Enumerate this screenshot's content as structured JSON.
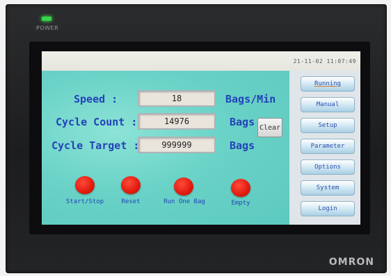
{
  "device": {
    "power_label": "POWER",
    "brand": "OMRON",
    "led_color": "#36d64a"
  },
  "screen": {
    "timestamp": "21-11-02 11:07:49",
    "speed": {
      "label": "Speed :",
      "value": "18",
      "unit": "Bags/Min"
    },
    "cycle_count": {
      "label": "Cycle Count :",
      "value": "14976",
      "unit": "Bags",
      "clear_label": "Clear"
    },
    "cycle_target": {
      "label": "Cycle Target :",
      "value": "999999",
      "unit": "Bags"
    },
    "actions": [
      {
        "label": "Start/Stop"
      },
      {
        "label": "Reset"
      },
      {
        "label": "Run One Bag"
      },
      {
        "label": "Empty"
      }
    ],
    "nav": [
      {
        "label": "Running",
        "active": true
      },
      {
        "label": "Manual"
      },
      {
        "label": "Setup"
      },
      {
        "label": "Parameter"
      },
      {
        "label": "Options"
      },
      {
        "label": "System"
      },
      {
        "label": "Login"
      }
    ],
    "colors": {
      "main_bg": "#6ad2c7",
      "label_text": "#2343b8",
      "action_button": "#e01b0e"
    }
  }
}
